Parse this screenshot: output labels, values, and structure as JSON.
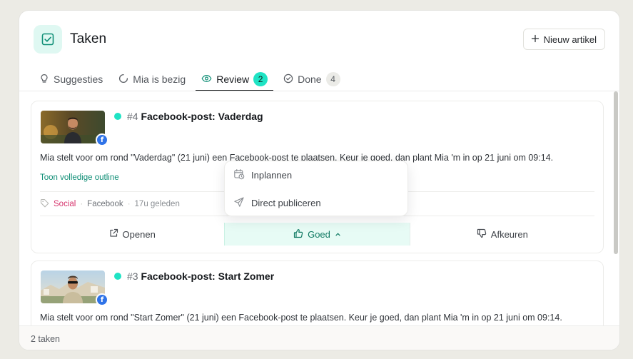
{
  "header": {
    "title": "Taken",
    "new_button_label": "Nieuw artikel"
  },
  "tabs": [
    {
      "label": "Suggesties",
      "icon": "lightbulb-icon"
    },
    {
      "label": "Mia is bezig",
      "icon": "loader-icon"
    },
    {
      "label": "Review",
      "icon": "eye-icon",
      "count": "2",
      "active": true
    },
    {
      "label": "Done",
      "icon": "check-circle-icon",
      "count": "4"
    }
  ],
  "cards": [
    {
      "number": "#4",
      "title": "Facebook-post: Vaderdag",
      "description": "Mia stelt voor om rond \"Vaderdag\" (21 juni) een Facebook-post te plaatsen. Keur je goed, dan plant Mia 'm in op 21 juni om 09:14.",
      "outline_link": "Toon volledige outline",
      "tag": "Social",
      "platform": "Facebook",
      "time": "17u geleden",
      "actions": {
        "open": "Openen",
        "approve": "Goed",
        "reject": "Afkeuren"
      }
    },
    {
      "number": "#3",
      "title": "Facebook-post: Start Zomer",
      "description": "Mia stelt voor om rond \"Start Zomer\" (21 juni) een Facebook-post te plaatsen. Keur je goed, dan plant Mia 'm in op 21 juni om 09:14."
    }
  ],
  "dropdown": {
    "schedule_label": "Inplannen",
    "publish_label": "Direct publiceren"
  },
  "footer": {
    "count_text": "2 taken"
  },
  "colors": {
    "accent": "#1fe3c4",
    "accent_dark": "#0f8e76",
    "social_tag": "#d6336c",
    "facebook": "#2f73e8"
  }
}
